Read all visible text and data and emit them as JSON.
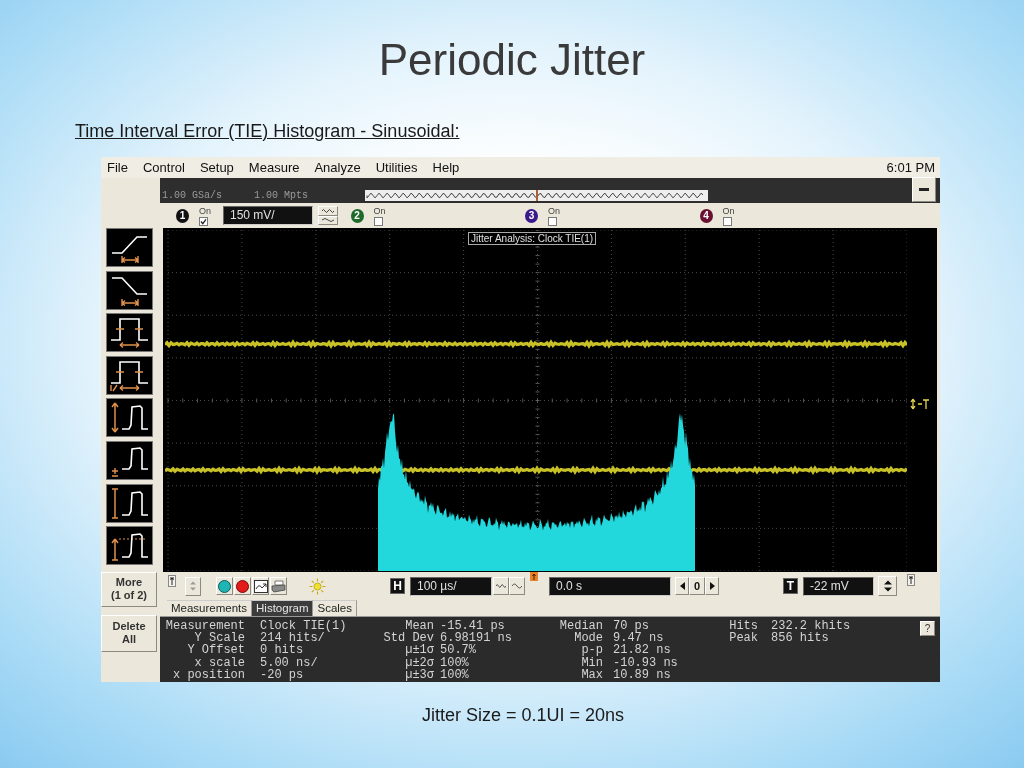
{
  "slide": {
    "title": "Periodic Jitter",
    "subtitle": "Time Interval Error (TIE) Histogram - Sinusoidal:",
    "caption": "Jitter Size = 0.1UI = 20ns"
  },
  "menu": [
    "File",
    "Control",
    "Setup",
    "Measure",
    "Analyze",
    "Utilities",
    "Help"
  ],
  "clock": "6:01 PM",
  "acquisition": {
    "sample_rate": "1.00 GSa/s",
    "memory_depth": "1.00 Mpts"
  },
  "channels": [
    {
      "number": "1",
      "color": "#111111",
      "on_label": "On",
      "on": true,
      "scale": "150 mV/"
    },
    {
      "number": "2",
      "color": "#1e6a2a",
      "on_label": "On",
      "on": false
    },
    {
      "number": "3",
      "color": "#3a1a8a",
      "on_label": "On",
      "on": false
    },
    {
      "number": "4",
      "color": "#6a1030",
      "on_label": "On",
      "on": false
    }
  ],
  "side_buttons": [
    {
      "lines": [
        "More",
        "(1 of 2)"
      ]
    },
    {
      "lines": [
        "Delete",
        "All"
      ]
    }
  ],
  "display": {
    "title": "Jitter Analysis: Clock TIE(1)"
  },
  "horizontal": {
    "label": "H",
    "scale": "100 µs/",
    "position": "0.0 s",
    "step": "0"
  },
  "trigger": {
    "label": "T",
    "level": "-22 mV"
  },
  "tabs": [
    {
      "label": "Measurements",
      "selected": false
    },
    {
      "label": "Histogram",
      "selected": true
    },
    {
      "label": "Scales",
      "selected": false
    }
  ],
  "measurements": [
    [
      {
        "label": "Measurement",
        "value": "Clock TIE(1)"
      },
      {
        "label": "Y Scale",
        "value": "214 hits/"
      },
      {
        "label": "Y Offset",
        "value": "0 hits"
      },
      {
        "label": "x scale",
        "value": "5.00 ns/"
      },
      {
        "label": "x position",
        "value": "-20 ps"
      }
    ],
    [
      {
        "label": "Mean",
        "value": "-15.41 ps"
      },
      {
        "label": "Std Dev",
        "value": "6.98191 ns"
      },
      {
        "label": "µ±1σ",
        "value": "50.7%"
      },
      {
        "label": "µ±2σ",
        "value": "100%"
      },
      {
        "label": "µ±3σ",
        "value": "100%"
      }
    ],
    [
      {
        "label": "Median",
        "value": "70 ps"
      },
      {
        "label": "Mode",
        "value": "9.47 ns"
      },
      {
        "label": "p-p",
        "value": "21.82 ns"
      },
      {
        "label": "Min",
        "value": "-10.93 ns"
      },
      {
        "label": "Max",
        "value": "10.89 ns"
      }
    ],
    [
      {
        "label": "Hits",
        "value": "232.2 khits"
      },
      {
        "label": "Peak",
        "value": "856 hits"
      }
    ]
  ],
  "help_button": "?"
}
